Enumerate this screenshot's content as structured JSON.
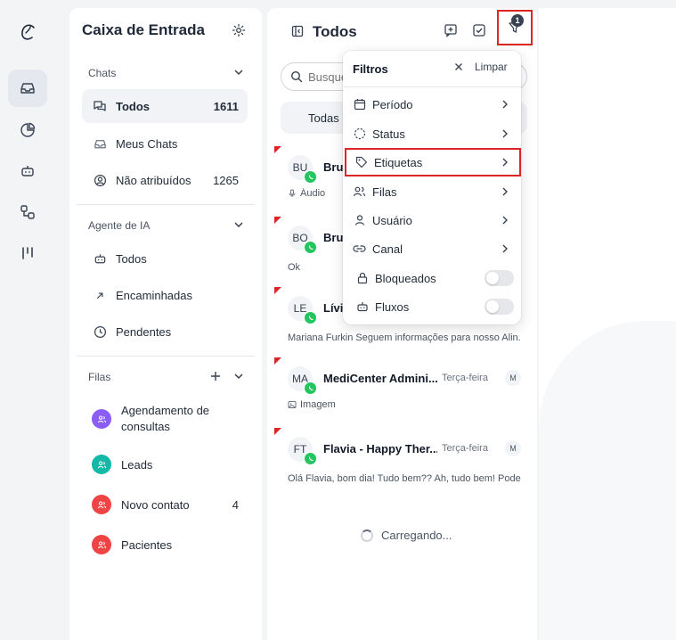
{
  "rail": {
    "items": [
      {
        "icon": "inbox-icon",
        "active": true
      },
      {
        "icon": "pie-chart-icon",
        "active": false
      },
      {
        "icon": "bot-icon",
        "active": false
      },
      {
        "icon": "flow-icon",
        "active": false
      },
      {
        "icon": "kanban-icon",
        "active": false
      }
    ]
  },
  "inbox": {
    "title": "Caixa de Entrada",
    "chats_section": "Chats",
    "chats_items": [
      {
        "label": "Todos",
        "count": "1611",
        "icon": "chats-icon",
        "active": true
      },
      {
        "label": "Meus Chats",
        "count": "",
        "icon": "inbox-icon",
        "active": false
      },
      {
        "label": "Não atribuídos",
        "count": "1265",
        "icon": "user-circle-icon",
        "active": false
      }
    ],
    "ai_section": "Agente de IA",
    "ai_items": [
      {
        "label": "Todos",
        "icon": "bot-icon"
      },
      {
        "label": "Encaminhadas",
        "icon": "arrow-up-right-icon"
      },
      {
        "label": "Pendentes",
        "icon": "clock-icon"
      }
    ],
    "queues_section": "Filas",
    "queues": [
      {
        "label": "Agendamento de consultas",
        "count": "",
        "color": "#8b5cf6"
      },
      {
        "label": "Leads",
        "count": "",
        "color": "#14b8a6"
      },
      {
        "label": "Novo contato",
        "count": "4",
        "color": "#ef4444"
      },
      {
        "label": "Pacientes",
        "count": "",
        "color": "#ef4444"
      }
    ]
  },
  "chats": {
    "title": "Todos",
    "search_placeholder": "Busque",
    "tab_label": "Todas",
    "loading": "Carregando...",
    "rows": [
      {
        "initials": "BU",
        "name": "Bru",
        "time": "",
        "assignee": "",
        "preview": "Áudio",
        "preview_icon": "mic-icon"
      },
      {
        "initials": "BO",
        "name": "Bru",
        "time": "",
        "assignee": "",
        "preview": "Ok",
        "preview_icon": ""
      },
      {
        "initials": "LE",
        "name": "Lívia",
        "time": "",
        "assignee": "",
        "preview": "Mariana Furkin Seguem informações para nosso Alin...",
        "preview_icon": ""
      },
      {
        "initials": "MA",
        "name": "MediCenter Admini...",
        "time": "Terça-feira",
        "assignee": "M",
        "preview": "Imagem",
        "preview_icon": "image-icon"
      },
      {
        "initials": "FT",
        "name": "Flavia - Happy Ther...",
        "time": "Terça-feira",
        "assignee": "M",
        "preview": "Olá Flavia, bom dia! Tudo bem?? Ah, tudo bem! Pode...",
        "preview_icon": ""
      }
    ]
  },
  "filters": {
    "title": "Filtros",
    "clear_label": "Limpar",
    "badge_count": "1",
    "items": [
      {
        "label": "Período",
        "icon": "calendar-icon",
        "type": "submenu"
      },
      {
        "label": "Status",
        "icon": "status-dashed-circle-icon",
        "type": "submenu"
      },
      {
        "label": "Etiquetas",
        "icon": "tag-icon",
        "type": "submenu",
        "highlighted": true
      },
      {
        "label": "Filas",
        "icon": "users-icon",
        "type": "submenu"
      },
      {
        "label": "Usuário",
        "icon": "user-icon",
        "type": "submenu"
      },
      {
        "label": "Canal",
        "icon": "link-icon",
        "type": "submenu"
      },
      {
        "label": "Bloqueados",
        "icon": "lock-icon",
        "type": "toggle",
        "on": false
      },
      {
        "label": "Fluxos",
        "icon": "bot-icon",
        "type": "toggle",
        "on": false
      }
    ]
  },
  "colors": {
    "highlight_border": "#dc2626",
    "whatsapp": "#22c55e"
  }
}
